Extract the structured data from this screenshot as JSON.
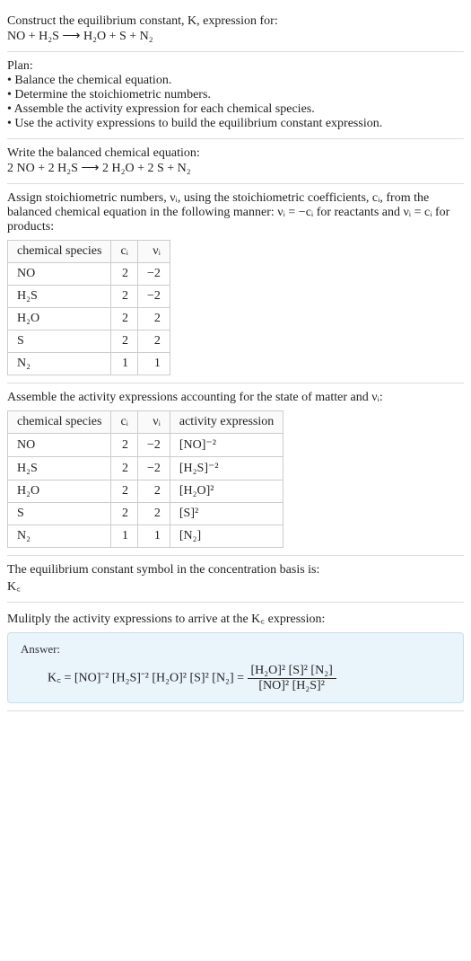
{
  "s1": {
    "title": "Construct the equilibrium constant, K, expression for:",
    "eq": "NO + H₂S ⟶ H₂O + S + N₂"
  },
  "s2": {
    "title": "Plan:",
    "b1": "• Balance the chemical equation.",
    "b2": "• Determine the stoichiometric numbers.",
    "b3": "• Assemble the activity expression for each chemical species.",
    "b4": "• Use the activity expressions to build the equilibrium constant expression."
  },
  "s3": {
    "title": "Write the balanced chemical equation:",
    "eq": "2 NO + 2 H₂S ⟶ 2 H₂O + 2 S + N₂"
  },
  "s4": {
    "title": "Assign stoichiometric numbers, νᵢ, using the stoichiometric coefficients, cᵢ, from the balanced chemical equation in the following manner: νᵢ = −cᵢ for reactants and νᵢ = cᵢ for products:",
    "h1": "chemical species",
    "h2": "cᵢ",
    "h3": "νᵢ",
    "r1c1": "NO",
    "r1c2": "2",
    "r1c3": "−2",
    "r2c1": "H₂S",
    "r2c2": "2",
    "r2c3": "−2",
    "r3c1": "H₂O",
    "r3c2": "2",
    "r3c3": "2",
    "r4c1": "S",
    "r4c2": "2",
    "r4c3": "2",
    "r5c1": "N₂",
    "r5c2": "1",
    "r5c3": "1"
  },
  "s5": {
    "title": "Assemble the activity expressions accounting for the state of matter and νᵢ:",
    "h1": "chemical species",
    "h2": "cᵢ",
    "h3": "νᵢ",
    "h4": "activity expression",
    "r1c1": "NO",
    "r1c2": "2",
    "r1c3": "−2",
    "r1c4": "[NO]⁻²",
    "r2c1": "H₂S",
    "r2c2": "2",
    "r2c3": "−2",
    "r2c4": "[H₂S]⁻²",
    "r3c1": "H₂O",
    "r3c2": "2",
    "r3c3": "2",
    "r3c4": "[H₂O]²",
    "r4c1": "S",
    "r4c2": "2",
    "r4c3": "2",
    "r4c4": "[S]²",
    "r5c1": "N₂",
    "r5c2": "1",
    "r5c3": "1",
    "r5c4": "[N₂]"
  },
  "s6": {
    "title": "The equilibrium constant symbol in the concentration basis is:",
    "sym": "K꜀"
  },
  "s7": {
    "title": "Mulitply the activity expressions to arrive at the K꜀ expression:"
  },
  "ans": {
    "label": "Answer:",
    "lhs": "K꜀ = [NO]⁻² [H₂S]⁻² [H₂O]² [S]² [N₂] = ",
    "top": "[H₂O]² [S]² [N₂]",
    "bot": "[NO]² [H₂S]²"
  }
}
